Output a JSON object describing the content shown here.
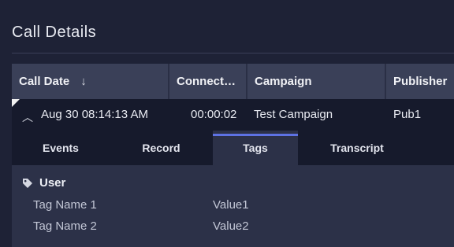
{
  "page": {
    "title": "Call Details"
  },
  "table": {
    "columns": [
      {
        "label": "Call Date",
        "sort": "↓"
      },
      {
        "label": "Connect…"
      },
      {
        "label": "Campaign"
      },
      {
        "label": "Publisher"
      }
    ],
    "row": {
      "expand_icon": "chevron-up-icon",
      "call_date": "Aug 30 08:14:13 AM",
      "connect": "00:00:02",
      "campaign": "Test Campaign",
      "publisher": "Pub1"
    }
  },
  "tabs": [
    {
      "label": "Events",
      "active": false
    },
    {
      "label": "Record",
      "active": false
    },
    {
      "label": "Tags",
      "active": true
    },
    {
      "label": "Transcript",
      "active": false
    }
  ],
  "tags_panel": {
    "group": {
      "icon": "tag-icon",
      "label": "User"
    },
    "items": [
      {
        "name": "Tag Name 1",
        "value": "Value1"
      },
      {
        "name": "Tag Name 2",
        "value": "Value2"
      }
    ]
  },
  "colors": {
    "background": "#1e2236",
    "header": "#3a4058",
    "row": "#161a2c",
    "panel": "#2c3148",
    "accent": "#5e72e4"
  }
}
